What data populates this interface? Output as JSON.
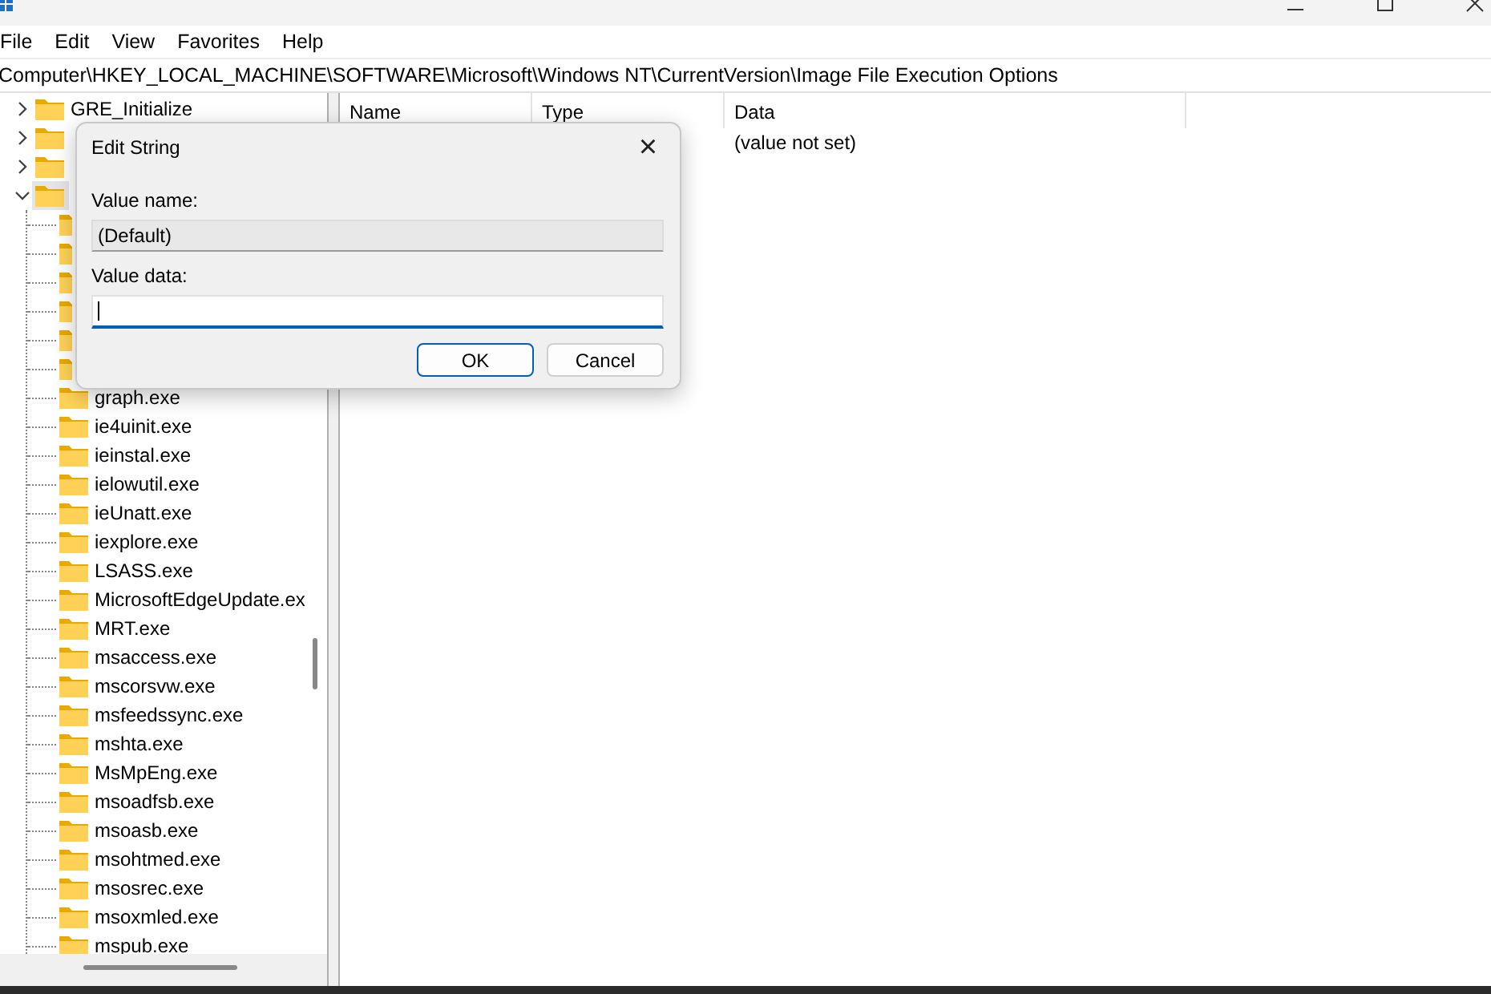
{
  "menu": [
    {
      "label": "File"
    },
    {
      "label": "Edit"
    },
    {
      "label": "View"
    },
    {
      "label": "Favorites"
    },
    {
      "label": "Help"
    }
  ],
  "address": "Computer\\HKEY_LOCAL_MACHINE\\SOFTWARE\\Microsoft\\Windows NT\\CurrentVersion\\Image File Execution Options",
  "tree": [
    {
      "label": "GRE_Initialize",
      "expanded": false,
      "selected": false
    },
    {
      "expanded": false,
      "selected": false
    },
    {
      "expanded": false,
      "selected": false
    },
    {
      "expanded": true,
      "selected": true,
      "children": [
        {
          "selected": false
        },
        {
          "selected": false
        },
        {
          "selected": false
        },
        {
          "selected": false
        },
        {
          "selected": false
        },
        {
          "selected": false
        },
        {
          "label": "graph.exe",
          "selected": false
        },
        {
          "label": "ie4uinit.exe",
          "selected": false
        },
        {
          "label": "ieinstal.exe",
          "selected": false
        },
        {
          "label": "ielowutil.exe",
          "selected": false
        },
        {
          "label": "ieUnatt.exe",
          "selected": false
        },
        {
          "label": "iexplore.exe",
          "selected": false
        },
        {
          "label": "LSASS.exe",
          "selected": false
        },
        {
          "label": "MicrosoftEdgeUpdate.ex",
          "selected": false
        },
        {
          "label": "MRT.exe",
          "selected": false
        },
        {
          "label": "msaccess.exe",
          "selected": false
        },
        {
          "label": "mscorsvw.exe",
          "selected": false
        },
        {
          "label": "msfeedssync.exe",
          "selected": false
        },
        {
          "label": "mshta.exe",
          "selected": false
        },
        {
          "label": "MsMpEng.exe",
          "selected": false
        },
        {
          "label": "msoadfsb.exe",
          "selected": false
        },
        {
          "label": "msoasb.exe",
          "selected": false
        },
        {
          "label": "msohtmed.exe",
          "selected": false
        },
        {
          "label": "msosrec.exe",
          "selected": false
        },
        {
          "label": "msoxmled.exe",
          "selected": false
        },
        {
          "label": "mspub.exe",
          "selected": false
        }
      ]
    }
  ],
  "list": {
    "columns": [
      "Name",
      "Type",
      "Data"
    ],
    "rows": [
      {
        "data": "(value not set)"
      }
    ]
  },
  "dialog": {
    "title": "Edit String",
    "close": "×",
    "value_name_label": "Value name:",
    "value_name": "(Default)",
    "value_data_label": "Value data:",
    "buttons": [
      {
        "label": "OK",
        "default": true
      },
      {
        "label": "Cancel",
        "default": false
      }
    ]
  }
}
